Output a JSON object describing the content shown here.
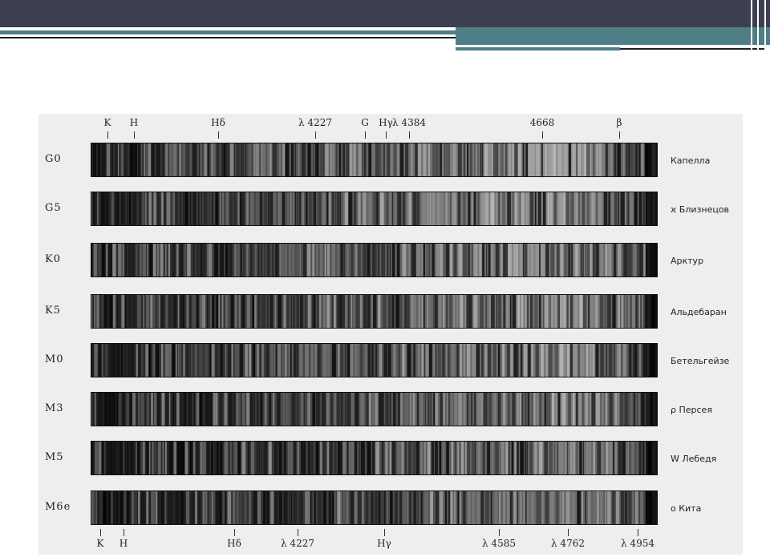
{
  "slide": {
    "bar_color": "#3d3e50",
    "accent_color": "#4e7f86"
  },
  "top_marks": [
    "K",
    "H",
    "Hδ",
    "λ 4227",
    "G",
    "Hγ",
    "λ 4384",
    "4668",
    "β"
  ],
  "bottom_marks": [
    "K",
    "H",
    "Hδ",
    "λ 4227",
    "Hγ",
    "λ 4585",
    "λ 4762",
    "λ 4954"
  ],
  "spectra": [
    {
      "cls": "G0",
      "star": "Капелла"
    },
    {
      "cls": "G5",
      "star": "ϰ Близнецов"
    },
    {
      "cls": "K0",
      "star": "Арктур"
    },
    {
      "cls": "K5",
      "star": "Альдебаран"
    },
    {
      "cls": "M0",
      "star": "Бетельгейзе"
    },
    {
      "cls": "M3",
      "star": "ρ Персея"
    },
    {
      "cls": "M5",
      "star": "W Лебедя"
    },
    {
      "cls": "M6e",
      "star": "ο Кита"
    }
  ]
}
